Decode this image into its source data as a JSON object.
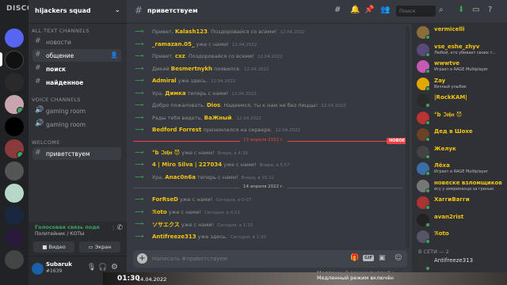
{
  "window": {
    "app_name": "DISCORD"
  },
  "guild": {
    "name": "hijackers squad"
  },
  "channels": {
    "cat_text": "ALL TEXT CHANNELS",
    "items_text": [
      {
        "label": "новости"
      },
      {
        "label": "общение"
      },
      {
        "label": "поиск"
      },
      {
        "label": "найденное"
      }
    ],
    "cat_voice": "VOICE CHANNELS",
    "items_voice": [
      {
        "label": "gaming room"
      },
      {
        "label": "gaming room"
      }
    ],
    "cat_welcome": "WELCOME",
    "items_welcome": [
      {
        "label": "приветствуем"
      }
    ]
  },
  "voice": {
    "status": "Голосовая связь подк",
    "sub": "Политейник / КОТЫ",
    "video_label": "Видео",
    "screen_label": "Экран"
  },
  "user": {
    "name": "Subaruk",
    "tag": "#1639"
  },
  "chat": {
    "channel": "приветствуем",
    "search_placeholder": "Поиск",
    "messages_top": [
      {
        "pre": "Привет, ",
        "name": "Kalash123",
        "post": ". Поздоровайся со всеми!",
        "time": "12.04.2022"
      },
      {
        "pre": "",
        "name": "_ramazan.05_",
        "post": " уже с нами!",
        "time": "12.04.2022"
      },
      {
        "pre": "Привет, ",
        "name": "cxz",
        "post": ". Поздоровайся со всеми!",
        "time": "12.04.2022"
      },
      {
        "pre": "Дикий ",
        "name": "Besmertnykh",
        "post": " появился.",
        "time": "12.04.2022"
      },
      {
        "pre": "",
        "name": "Admiral",
        "post": " уже здесь.",
        "time": "12.04.2022"
      },
      {
        "pre": "Ура, ",
        "name": "Димка",
        "post": " теперь с нами!",
        "time": "12.04.2022"
      },
      {
        "pre": "Добро пожаловать, ",
        "name": "Dios",
        "post": ". Надеемся, ты к нам не без пиццы!",
        "time": "12.04.2022"
      },
      {
        "pre": "Рады тебя видеть, ",
        "name": "BaЖный",
        "post": ".",
        "time": "12.04.2022"
      },
      {
        "pre": "",
        "name": "Bedford Forrest",
        "post": " приземлился на сервере.",
        "time": "12.04.2022"
      }
    ],
    "divider1": "13 апреля 2022 г.",
    "new_badge": "НОВОЕ",
    "messages_mid": [
      {
        "pre": "",
        "name": "°b ℑ𝔬𝔥𝔫 😈",
        "post": " уже с нами!",
        "time": "Вчера, в 4:39"
      },
      {
        "pre": "",
        "name": "4 | Miro Silva | 227034",
        "post": " уже с нами!",
        "time": "Вчера, в 5:57"
      },
      {
        "pre": "Ура, ",
        "name": "Anac0n6a",
        "post": " теперь с нами!",
        "time": "Вчера, в 15:12"
      }
    ],
    "divider2": "14 апреля 2022 г.",
    "messages_bot": [
      {
        "pre": "",
        "name": "ForRseD",
        "post": " уже с нами!",
        "time": "Сегодня, в 0:07"
      },
      {
        "pre": "",
        "name": "ℜoto",
        "post": " уже с нами!",
        "time": "Сегодня, в 0:11"
      },
      {
        "pre": "",
        "name": "ソサエクス",
        "post": " уже с нами!",
        "time": "Сегодня, в 1:15"
      },
      {
        "pre": "",
        "name": "Antifreeze313",
        "post": " уже здесь.",
        "time": "Сегодня, в 1:30"
      }
    ],
    "composer_placeholder": "Написать #приветствуем",
    "gif_label": "GIF",
    "slowmode": "Медленный режим включён"
  },
  "members": {
    "list": [
      {
        "name": "vermicelli",
        "activity": "",
        "color": "#f1c40f"
      },
      {
        "name": "vse_eshe_zhyv",
        "activity": "Любой, кто убивает своих т...",
        "color": "#f1c40f"
      },
      {
        "name": "wwwtve",
        "activity": "Играет в RAGE Multiplayer",
        "color": "#f1c40f"
      },
      {
        "name": "Zay",
        "activity": "Вечный улыбак",
        "color": "#f1c40f"
      },
      {
        "name": "|RockKAM|",
        "activity": "",
        "color": "#f1c40f"
      },
      {
        "name": "°b ℑ𝔬𝔥𝔫 😈",
        "activity": "",
        "color": "#f1c40f"
      },
      {
        "name": "Дед в Шохе",
        "activity": "",
        "color": "#f1c40f"
      },
      {
        "name": "Желук",
        "activity": "",
        "color": "#f1c40f"
      },
      {
        "name": "Лёха",
        "activity": "Играет в RAGE Multiplayer",
        "color": "#f1c40f"
      },
      {
        "name": "новеске взломщиков",
        "activity": "есу у американца за гранью",
        "color": "#f1c40f"
      },
      {
        "name": "ХаггиВагги",
        "activity": "",
        "color": "#f1c40f"
      },
      {
        "name": "avan2rist",
        "activity": "",
        "color": "#f1c40f"
      },
      {
        "name": "ℜoto",
        "activity": "",
        "color": "#f1c40f"
      }
    ],
    "online_header": "В СЕТИ — 2",
    "online": [
      {
        "name": "Antifreeze313",
        "activity": "",
        "color": "#dcddde"
      }
    ]
  },
  "overlay": {
    "clock": "01:30",
    "date": "14.04.2022",
    "slowmode": "Медленный режим включён"
  },
  "colors": {
    "accent_green": "#3ba55d",
    "name_yellow": "#f1c40f",
    "new_red": "#ed4245"
  }
}
